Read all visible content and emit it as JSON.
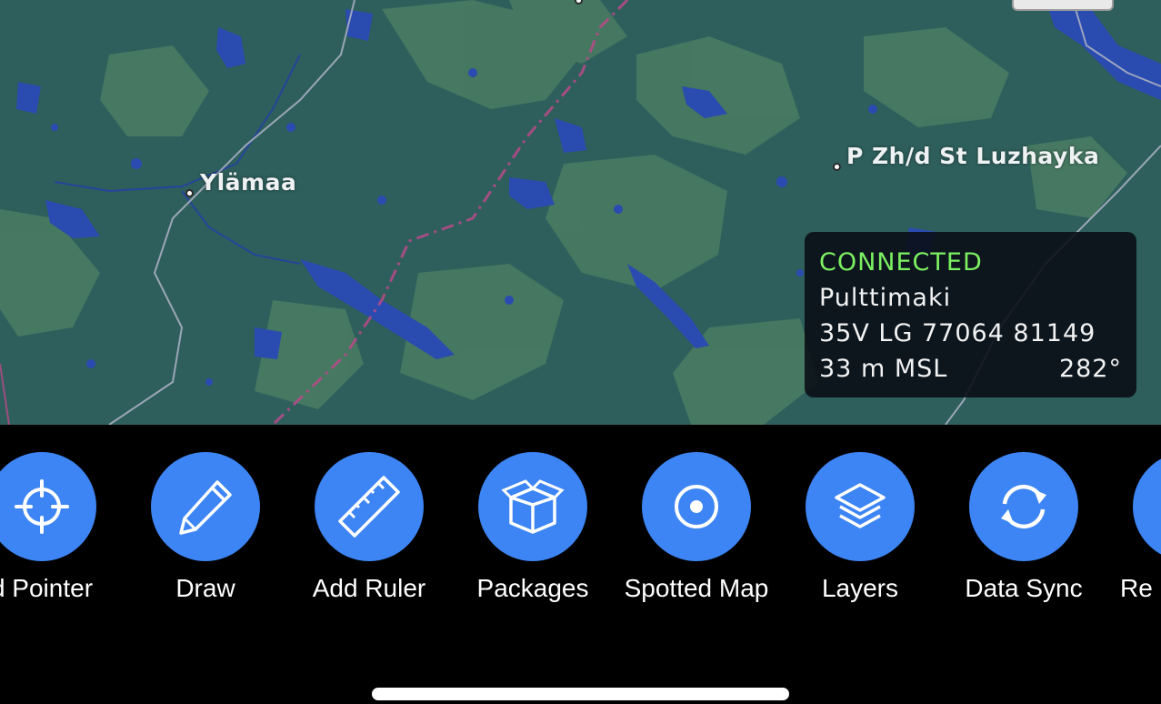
{
  "map": {
    "places": [
      {
        "name": "Ylämaa"
      },
      {
        "name": "P Zh/d St Luzhayka"
      }
    ]
  },
  "info_panel": {
    "status": "CONNECTED",
    "location": "Pulttimaki",
    "grid": "35V LG 77064 81149",
    "altitude": "33 m MSL",
    "heading": "282°"
  },
  "toolbar": {
    "items": [
      {
        "label": "d Pointer",
        "icon": "crosshair-icon"
      },
      {
        "label": "Draw",
        "icon": "pencil-icon"
      },
      {
        "label": "Add Ruler",
        "icon": "ruler-icon"
      },
      {
        "label": "Packages",
        "icon": "package-icon"
      },
      {
        "label": "Spotted Map",
        "icon": "target-icon"
      },
      {
        "label": "Layers",
        "icon": "layers-icon"
      },
      {
        "label": "Data Sync",
        "icon": "sync-icon"
      },
      {
        "label": "Re",
        "icon": "partial-icon"
      }
    ],
    "accent": "#3d85f4"
  }
}
